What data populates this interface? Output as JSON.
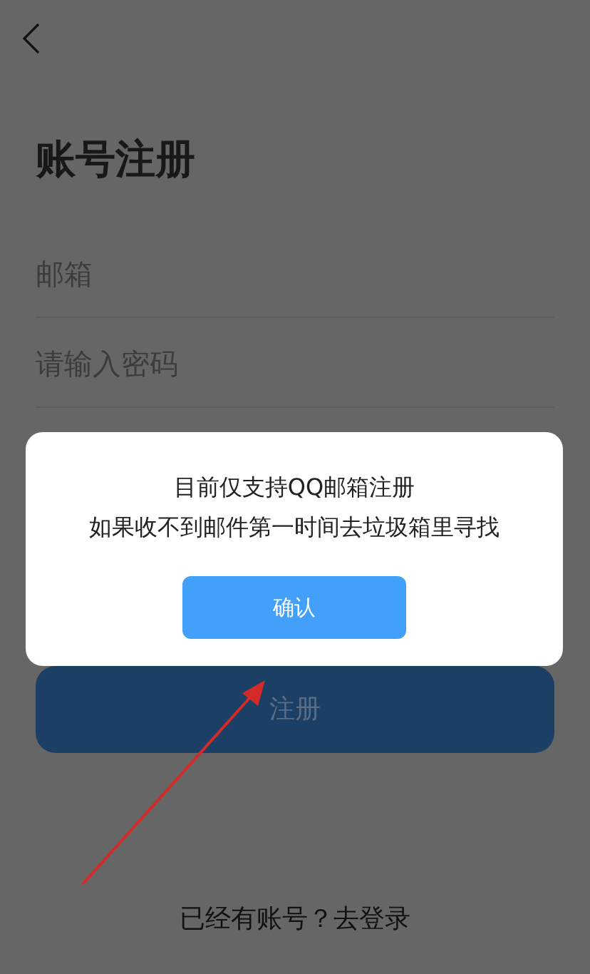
{
  "title": "账号注册",
  "fields": [
    {
      "placeholder": "邮箱"
    },
    {
      "placeholder": "请输入密码"
    }
  ],
  "register_button": {
    "label": "注册",
    "disabled": true
  },
  "login_prompt": "已经有账号？去登录",
  "dialog": {
    "lines": [
      "目前仅支持QQ邮箱注册",
      "如果收不到邮件第一时间去垃圾箱里寻找"
    ],
    "confirm_button": "确认"
  }
}
